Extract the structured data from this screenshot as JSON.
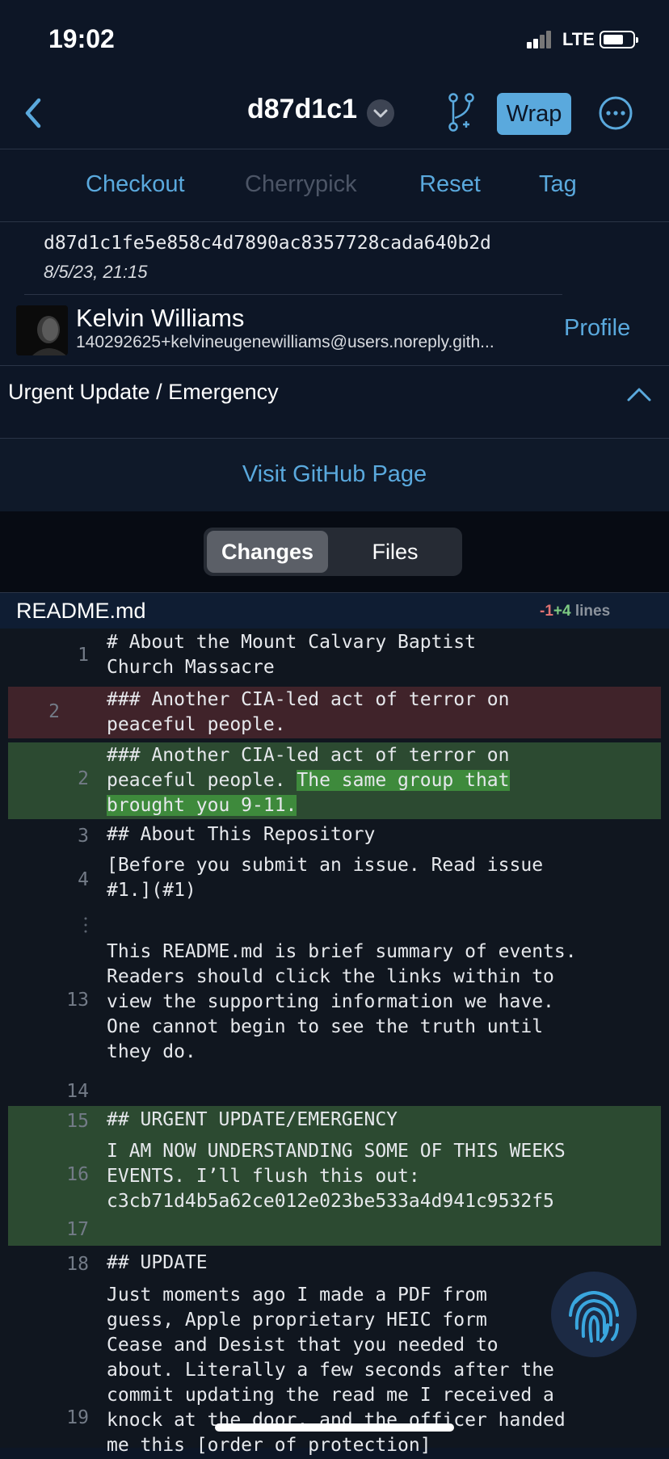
{
  "status_bar": {
    "time": "19:02",
    "network": "LTE"
  },
  "nav": {
    "title": "d87d1c1",
    "wrap_label": "Wrap"
  },
  "actions": [
    "Checkout",
    "Cherrypick",
    "Reset",
    "Tag"
  ],
  "commit": {
    "hash": "d87d1c1fe5e858c4d7890ac8357728cada640b2d",
    "date": "8/5/23, 21:15",
    "author_name": "Kelvin Williams",
    "author_email": "140292625+kelvineugenewilliams@users.noreply.gith...",
    "profile_label": "Profile",
    "message": "Urgent Update / Emergency",
    "visit_label": "Visit GitHub Page"
  },
  "segments": {
    "active": "Changes",
    "inactive": "Files"
  },
  "file": {
    "name": "README.md",
    "deleted": "-1",
    "added": "+4",
    "lines_label": "lines"
  },
  "diff": {
    "l1": "1",
    "c1": "# About the Mount Calvary Baptist\nChurch Massacre",
    "l2del": "2",
    "c2del": "### Another CIA-led act of terror on\npeaceful people.",
    "l2add": "2",
    "c2add_a": "### Another CIA-led act of terror on\npeaceful people. ",
    "c2add_hl1": "The same group that",
    "c2add_hl2": "brought you 9-11.",
    "l3": "3",
    "c3": "## About This Repository",
    "l4": "4",
    "c4": "[Before you submit an issue. Read issue\n#1.](#1)",
    "l13": "13",
    "c13": "This README.md is brief summary of events.\nReaders should click the links within to\nview the supporting information we have.\nOne cannot begin to see the truth until\nthey do.",
    "l14": "14",
    "l15": "15",
    "c15": "## URGENT UPDATE/EMERGENCY",
    "l16": "16",
    "c16": "I AM NOW UNDERSTANDING SOME OF THIS WEEKS\nEVENTS. I’ll flush this out:\nc3cb71d4b5a62ce012e023be533a4d941c9532f5",
    "l17": "17",
    "l18": "18",
    "c18": "## UPDATE",
    "l19": "19",
    "c19": "Just moments ago I made a PDF from\nguess, Apple proprietary HEIC form\nCease and Desist that you needed to\nabout. Literally a few seconds after the\ncommit updating the read me I received a\nknock at the door, and the officer handed\nme this [order of protection]"
  },
  "colors": {
    "accent": "#5aa9dd",
    "background": "#0d1626",
    "deleted_row": "#40232a",
    "added_row": "#2c4a31",
    "added_highlight": "#3e8a3c"
  },
  "icons": [
    "back-chevron-icon",
    "dropdown-chevron-icon",
    "branch-icon",
    "more-icon",
    "chevron-up-icon",
    "fingerprint-icon"
  ]
}
